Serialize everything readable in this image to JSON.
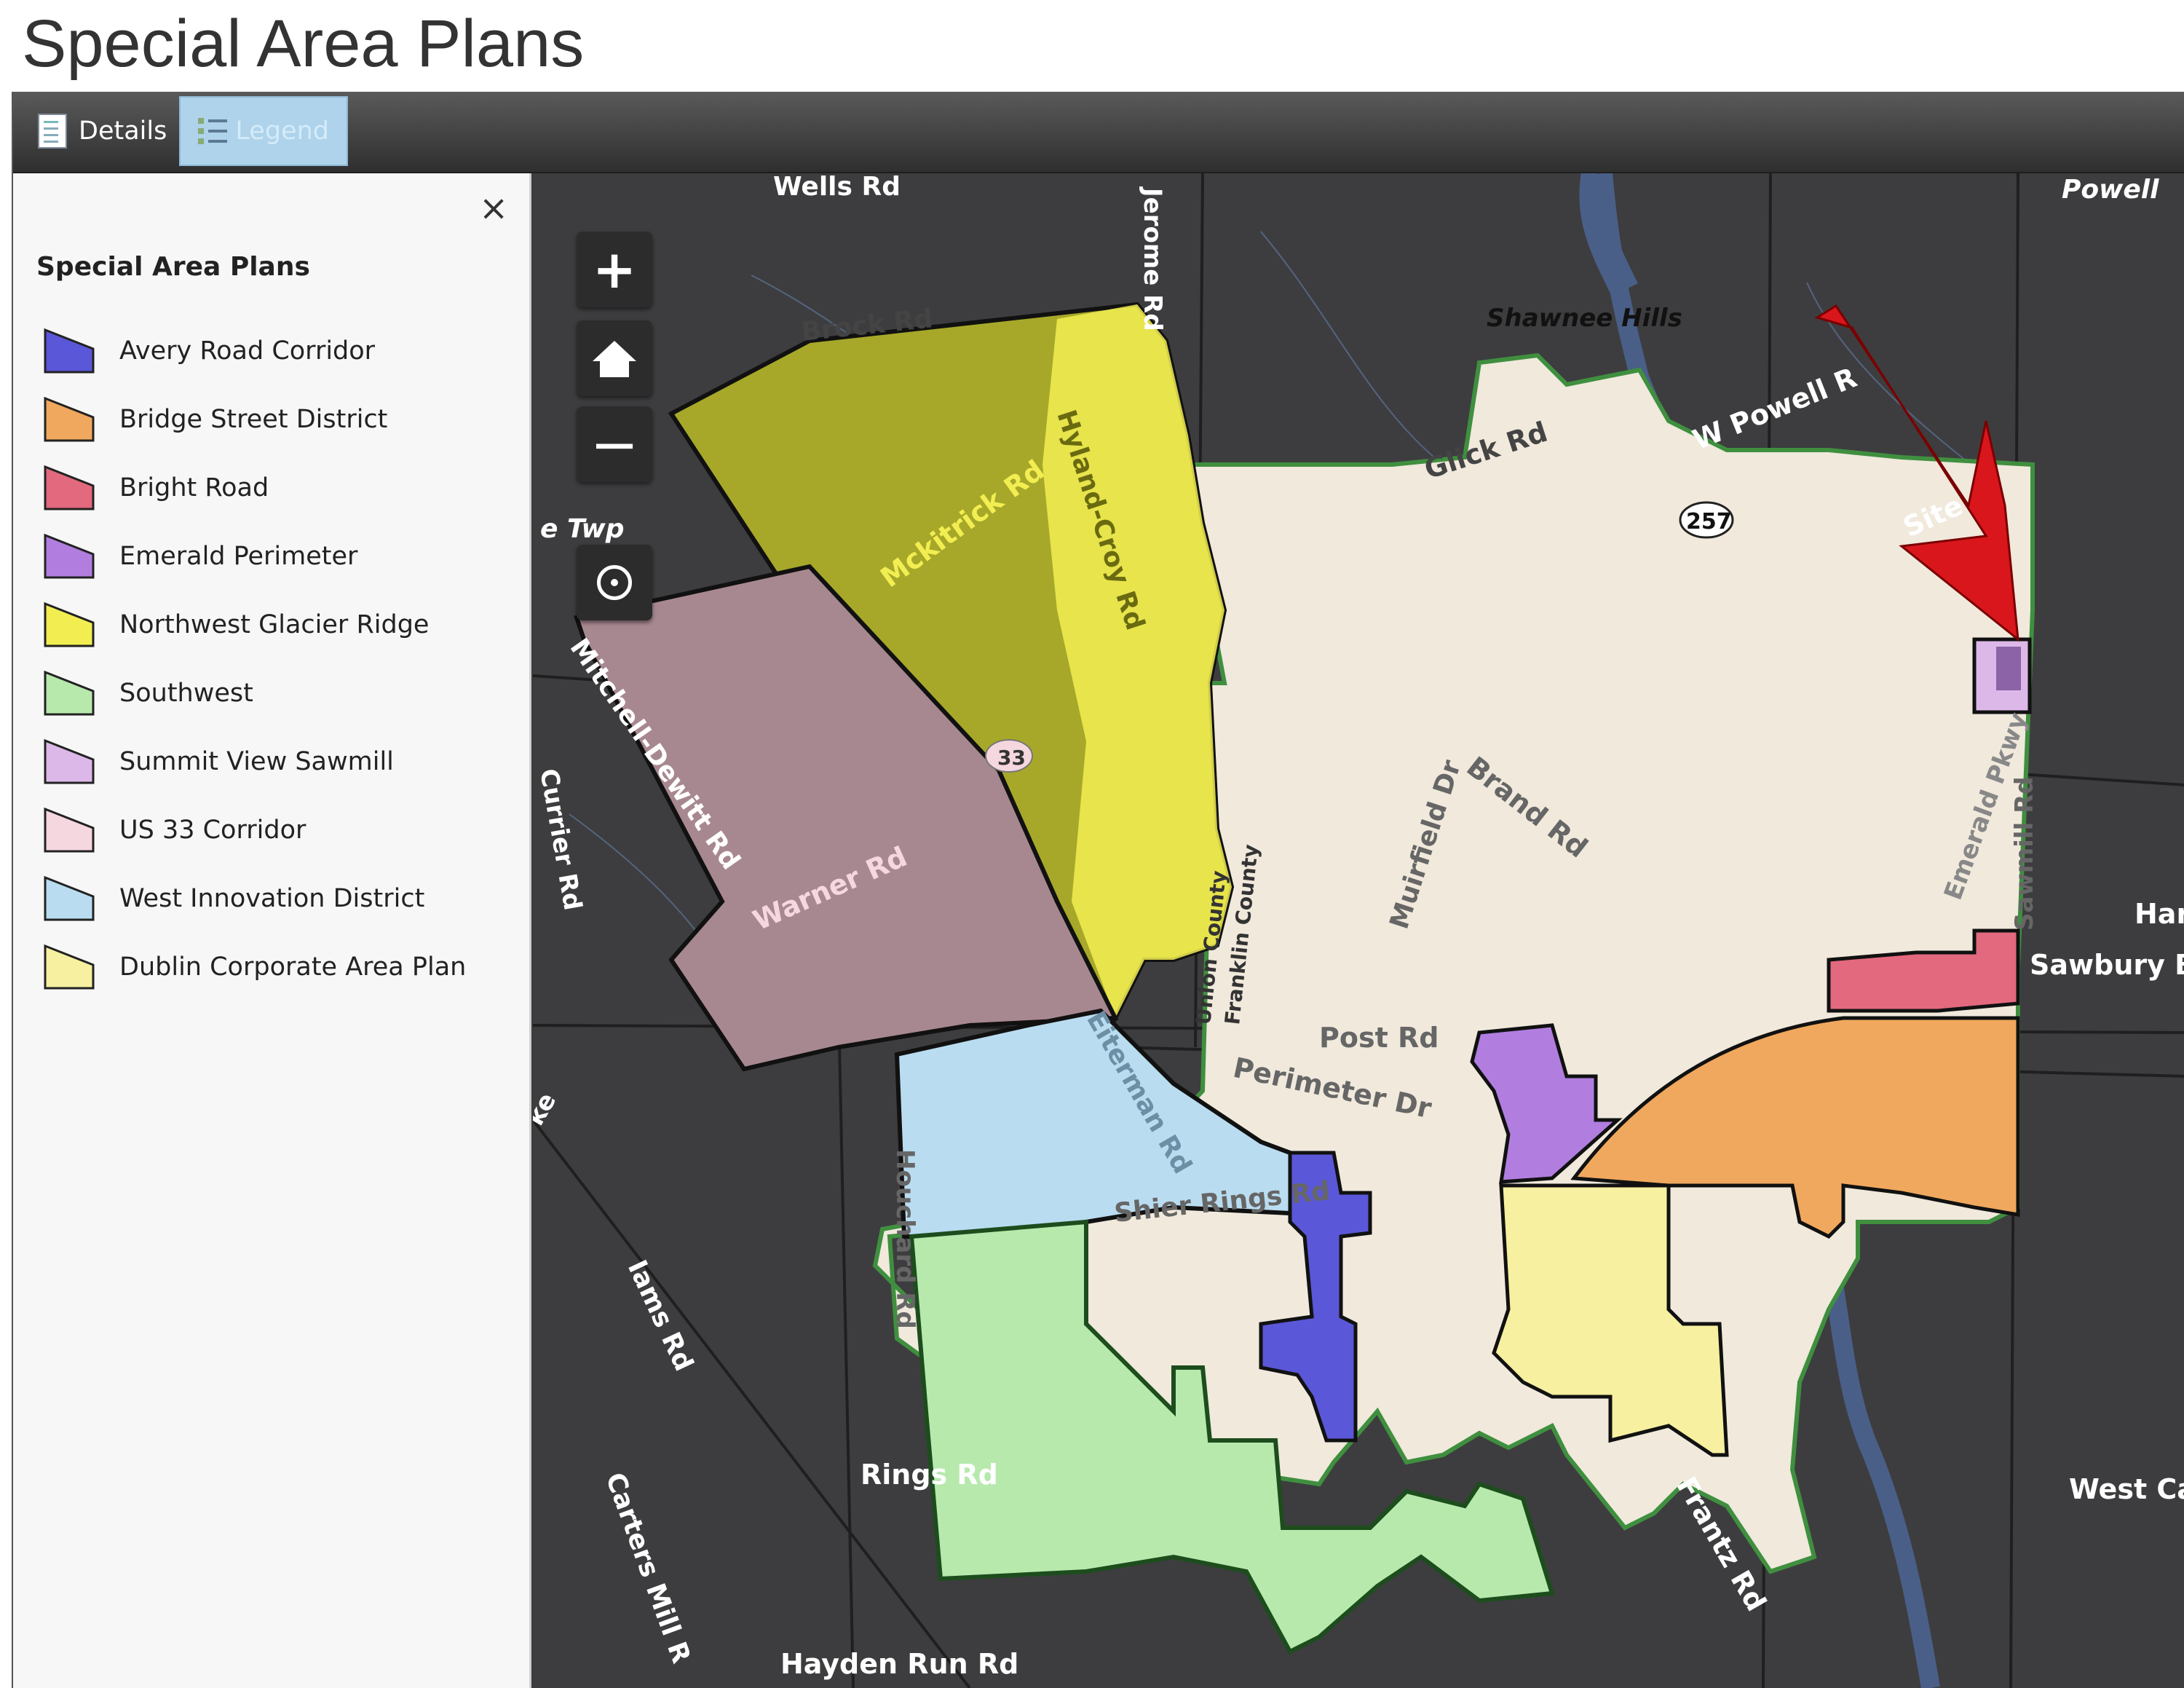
{
  "page": {
    "title": "Special Area Plans"
  },
  "toolbar": {
    "tabs": [
      {
        "label": "Details",
        "icon": "details-icon",
        "active": false
      },
      {
        "label": "Legend",
        "icon": "legend-icon",
        "active": true
      }
    ]
  },
  "legend": {
    "close_label": "×",
    "title": "Special Area Plans",
    "items": [
      {
        "label": "Avery Road Corridor",
        "color": "#5a57d8"
      },
      {
        "label": "Bridge Street District",
        "color": "#f0a85e"
      },
      {
        "label": "Bright Road",
        "color": "#e2697e"
      },
      {
        "label": "Emerald Perimeter",
        "color": "#b17ee0"
      },
      {
        "label": "Northwest Glacier Ridge",
        "color": "#f2ee52"
      },
      {
        "label": "Southwest",
        "color": "#b7e9ad"
      },
      {
        "label": "Summit View Sawmill",
        "color": "#dcb8e8"
      },
      {
        "label": "US 33 Corridor",
        "color": "#f5d7df"
      },
      {
        "label": "West Innovation District",
        "color": "#b9dcf0"
      },
      {
        "label": "Dublin Corporate Area Plan",
        "color": "#f6f0a0"
      }
    ]
  },
  "map": {
    "controls": {
      "zoom_in": "+",
      "zoom_out": "−"
    },
    "labels": {
      "wells_rd": "Wells Rd",
      "powell": "Powell",
      "jerome_rd": "Jerome Rd",
      "brock_rd": "Brock Rd",
      "shawnee_hills": "Shawnee Hills",
      "glick_rd": "Glick Rd",
      "w_powell_rd": "W Powell R",
      "route_257": "257",
      "site": "Site",
      "twp": "e Twp",
      "mckitrick_rd": "Mckitrick Rd",
      "hyland_croy_rd": "Hyland-Croy Rd",
      "mitchell_dewitt_rd": "Mitchell-Dewitt Rd",
      "route_33": "33",
      "warner_rd": "Warner Rd",
      "currier_rd": "Currier Rd",
      "muirfield_dr": "Muirfield Dr",
      "brand_rd": "Brand Rd",
      "sawmill_rd": "Sawmill Rd",
      "emerald_pkwy": "Emerald Pkwy",
      "har": "Har",
      "sawbury_b": "Sawbury B",
      "union_county": "Union County",
      "franklin_county": "Franklin County",
      "post_rd": "Post Rd",
      "perimeter_dr": "Perimeter Dr",
      "eiterman_rd": "Eiterman Rd",
      "shier_rings_rd": "Shier Rings Rd",
      "houchard_rd": "Houchard Rd",
      "ke": "ke",
      "iams_rd": "Iams Rd",
      "rings_rd": "Rings Rd",
      "frantz_rd": "Frantz Rd",
      "carters_mill_rd": "Carters Mill R",
      "west_ca": "West Ca",
      "hayden_run_rd": "Hayden Run Rd"
    }
  }
}
